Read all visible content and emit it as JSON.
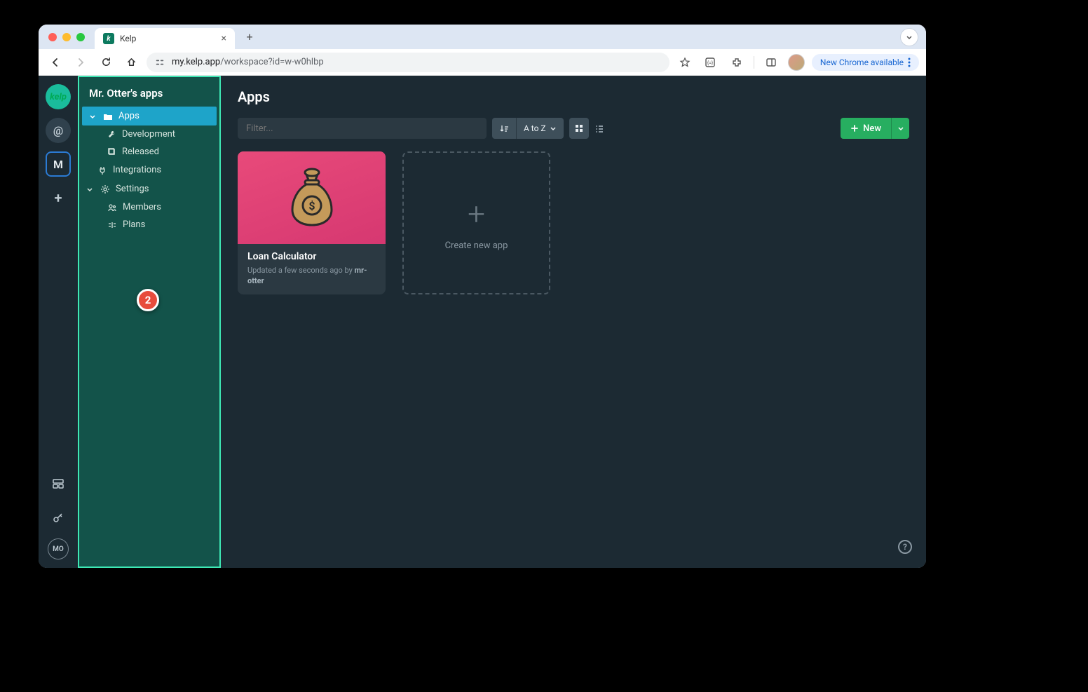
{
  "browser": {
    "tab_title": "Kelp",
    "url_host": "my.kelp.app",
    "url_path": "/workspace?id=w-w0hlbp",
    "update_chip": "New Chrome available"
  },
  "rail": {
    "at": "@",
    "m": "M",
    "avatar": "MO"
  },
  "sidebar": {
    "title": "Mr. Otter's apps",
    "items": {
      "apps": "Apps",
      "development": "Development",
      "released": "Released",
      "integrations": "Integrations",
      "settings": "Settings",
      "members": "Members",
      "plans": "Plans"
    },
    "badge": "2"
  },
  "main": {
    "heading": "Apps",
    "filter_placeholder": "Filter...",
    "sort_label": "A to Z",
    "new_label": "New",
    "create_label": "Create new app"
  },
  "app_card": {
    "title": "Loan Calculator",
    "meta_prefix": "Updated a few seconds ago by ",
    "meta_author": "mr-otter"
  }
}
